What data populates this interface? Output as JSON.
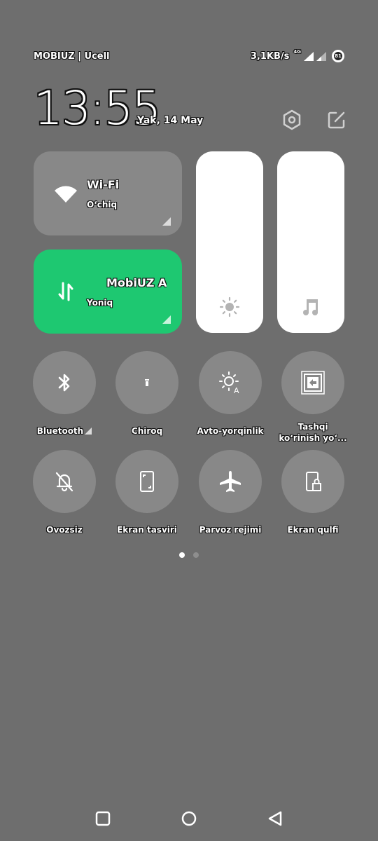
{
  "status_bar": {
    "carrier": "MOBIUZ | Ucell",
    "network_speed": "3,1KB/s",
    "network_type": "4G",
    "battery_level": "81"
  },
  "header": {
    "time": "13:55",
    "date": "Yak, 14 May",
    "settings_icon": "settings-hexagon-icon",
    "edit_icon": "edit-icon"
  },
  "tiles": {
    "wifi": {
      "title": "Wi-Fi",
      "status": "O‘chiq",
      "icon": "wifi-icon",
      "active": false
    },
    "mobile_data": {
      "title": "MobiUZ Ar",
      "status": "Yoniq",
      "icon": "mobile-data-icon",
      "active": true,
      "color": "#1ec871"
    }
  },
  "sliders": {
    "brightness": {
      "icon": "sun-icon",
      "level_percent": 100
    },
    "volume": {
      "icon": "music-note-icon",
      "level_percent": 100
    }
  },
  "toggles": [
    {
      "id": "bluetooth",
      "label": "Bluetooth",
      "icon": "bluetooth-icon",
      "has_expand": true
    },
    {
      "id": "flashlight",
      "label": "Chiroq",
      "icon": "flashlight-icon"
    },
    {
      "id": "auto-brightness",
      "label": "Avto-yorqinlik",
      "icon": "auto-brightness-icon"
    },
    {
      "id": "cast",
      "label": "Tashqi ko‘rinish yo‘...",
      "icon": "cast-screen-icon"
    },
    {
      "id": "silent",
      "label": "Ovozsiz",
      "icon": "bell-off-icon"
    },
    {
      "id": "screenshot",
      "label": "Ekran tasviri",
      "icon": "screenshot-icon"
    },
    {
      "id": "airplane",
      "label": "Parvoz rejimi",
      "icon": "airplane-icon"
    },
    {
      "id": "lock-screen",
      "label": "Ekran qulfi",
      "icon": "lock-screen-icon"
    }
  ],
  "pagination": {
    "current": 1,
    "total": 2
  },
  "nav_bar": {
    "recents": "recents-icon",
    "home": "home-icon",
    "back": "back-icon"
  }
}
